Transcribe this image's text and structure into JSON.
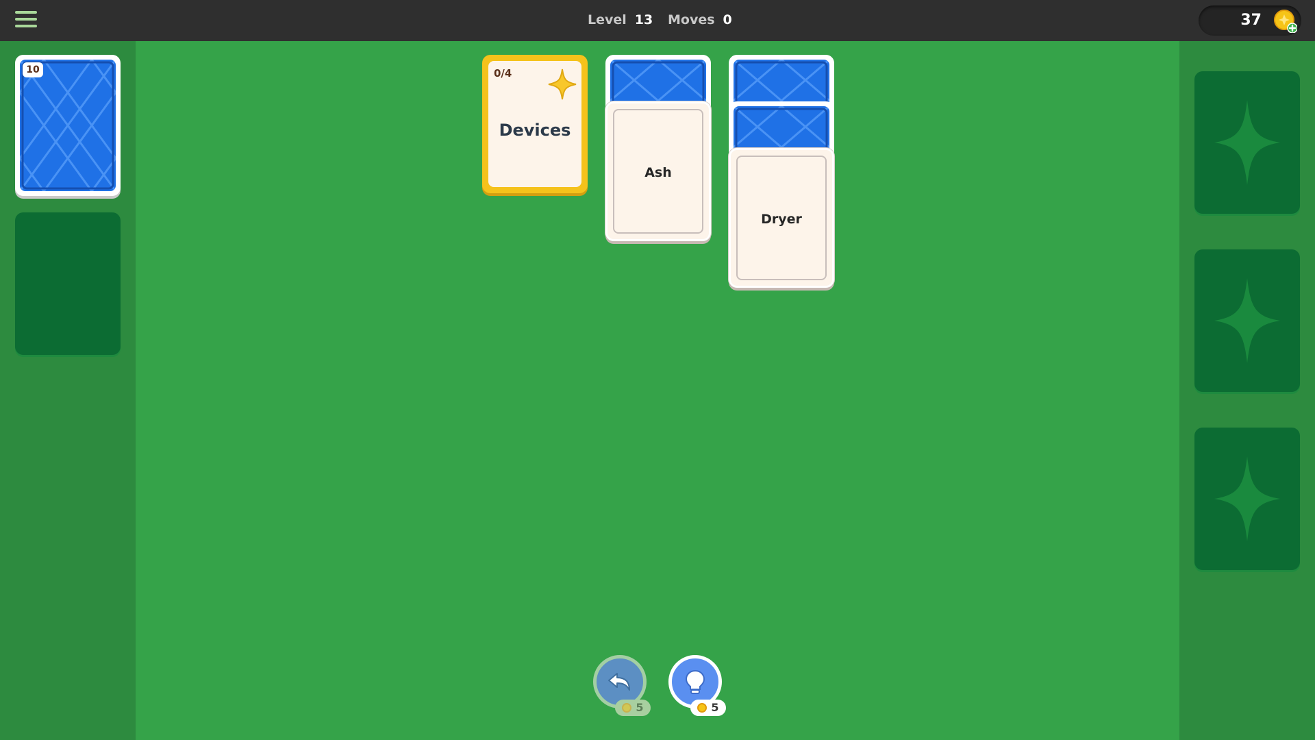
{
  "topbar": {
    "level_label": "Level",
    "level_value": "13",
    "moves_label": "Moves",
    "moves_value": "0",
    "coins": "37",
    "menu_icon": "hamburger-menu-icon",
    "coin_icon": "coin-plus-icon"
  },
  "stock": {
    "remaining": "10"
  },
  "category_card": {
    "progress": "0/4",
    "title": "Devices",
    "icon": "sparkle-star-icon"
  },
  "columns": [
    {
      "face_down": 1,
      "face_up": "Ash"
    },
    {
      "face_down": 2,
      "face_up": "Dryer"
    }
  ],
  "foundation_slots": [
    {
      "icon": "sparkle-star-icon"
    },
    {
      "icon": "sparkle-star-icon"
    },
    {
      "icon": "sparkle-star-icon"
    }
  ],
  "actions": {
    "undo": {
      "icon": "undo-arrow-icon",
      "cost": "5"
    },
    "hint": {
      "icon": "lightbulb-icon",
      "cost": "5"
    }
  },
  "colors": {
    "table": "#35a349",
    "side_panel": "#2d8b3f",
    "topbar": "#2f2f2f",
    "card_back": "#1f71e6",
    "category_card": "#f5c21b",
    "empty_slot": "#0c6c33"
  }
}
